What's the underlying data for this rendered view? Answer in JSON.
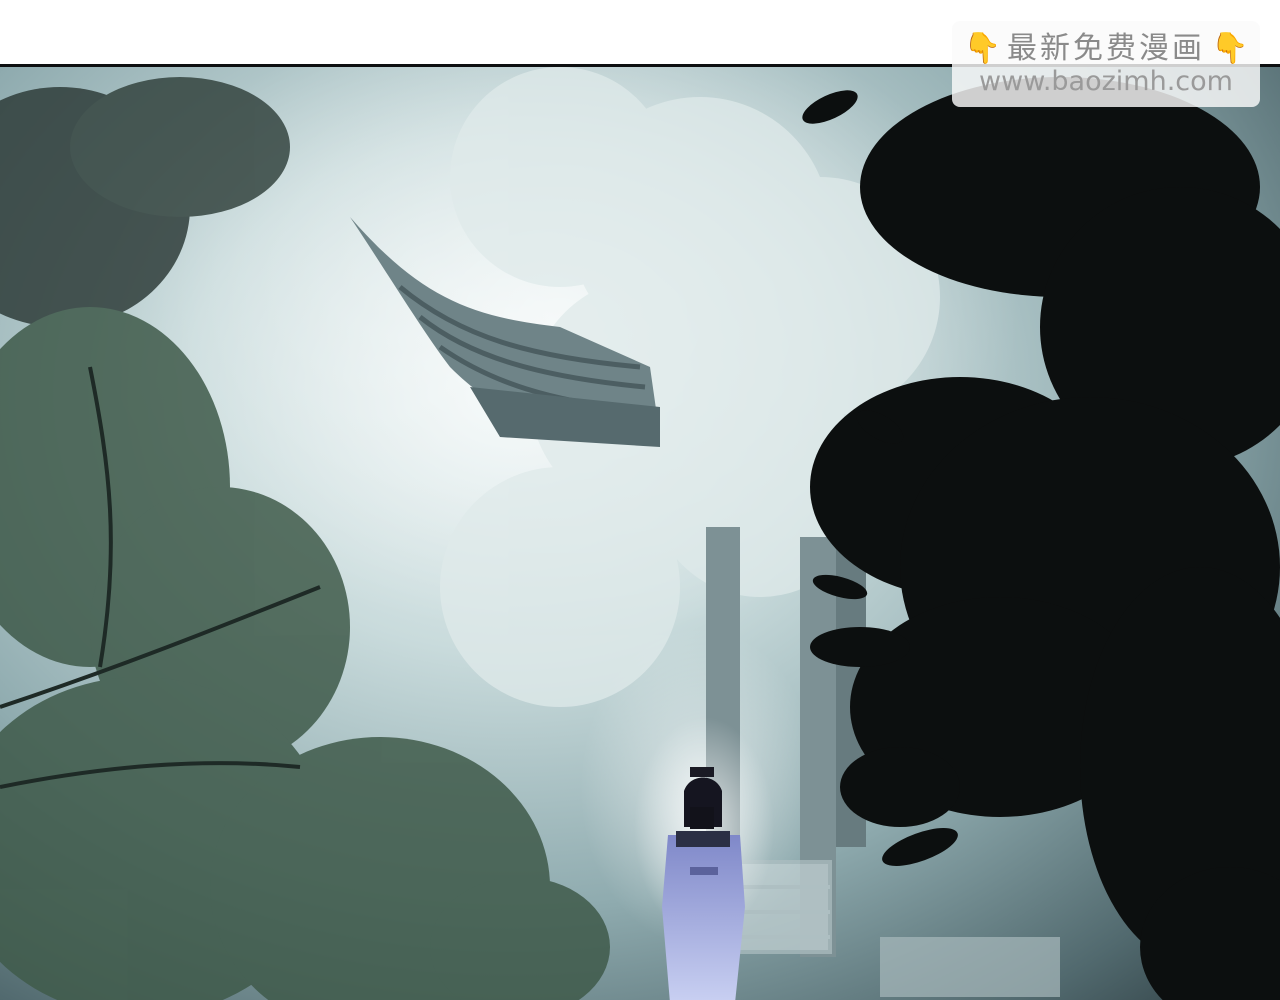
{
  "page": {
    "background": "#ffffff",
    "panel_border_color": "#0d0f10"
  },
  "watermark": {
    "title": "最新免费漫画",
    "url": "www.baozimh.com",
    "hand_icon": "pointing-down-hand-icon",
    "accent_color": "#f3b51c"
  },
  "scene": {
    "palette": {
      "mist": "#dfeaea",
      "foliage_dark": "#0c0f0f",
      "foliage_green": "#3f5a4a",
      "stone": "#6f8488",
      "robe": "#9aa7dc"
    }
  }
}
